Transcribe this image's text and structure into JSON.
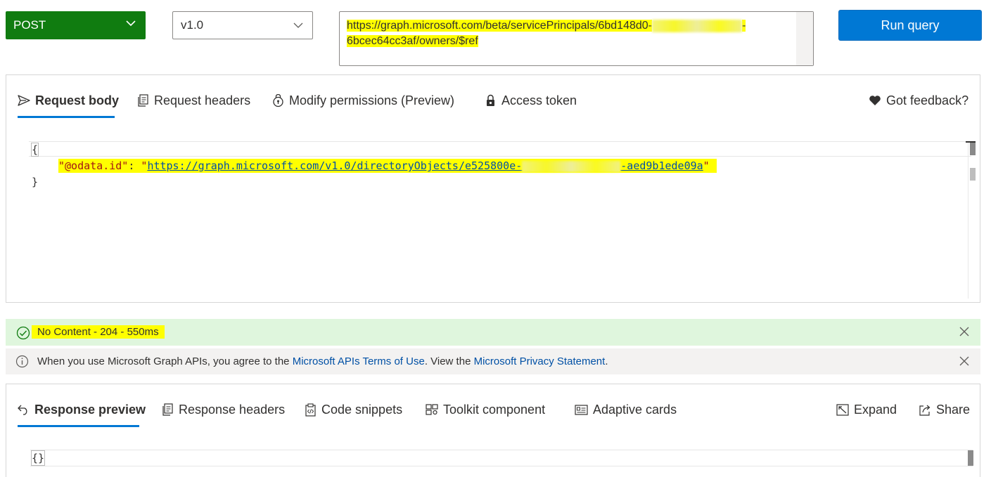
{
  "toolbar": {
    "method": "POST",
    "version": "v1.0",
    "url_line1_start": "https://graph.microsoft.com/beta/servicePrincipals/6bd148d0-",
    "url_line1_end": "-",
    "url_line2": "6bcec64cc3af/owners/$ref",
    "run_label": "Run query"
  },
  "request_tabs": [
    {
      "label": "Request body",
      "icon": "send-icon"
    },
    {
      "label": "Request headers",
      "icon": "headers-icon"
    },
    {
      "label": "Modify permissions (Preview)",
      "icon": "lock-key-icon"
    },
    {
      "label": "Access token",
      "icon": "shield-lock-icon"
    }
  ],
  "feedback_label": "Got feedback?",
  "request_body": {
    "open_brace": "{",
    "key": "\"@odata.id\"",
    "colon": ": ",
    "value_start": "https://graph.microsoft.com/v1.0/directoryObjects/e525800e-",
    "value_end": "-aed9b1ede09a",
    "close_brace": "}"
  },
  "status": {
    "text": "No Content - 204 - 550ms",
    "color": "#dff6dd"
  },
  "info": {
    "prefix": "When you use Microsoft Graph APIs, you agree to the ",
    "terms_link": "Microsoft APIs Terms of Use",
    "middle": ". View the ",
    "privacy_link": "Microsoft Privacy Statement",
    "suffix": "."
  },
  "response_tabs": [
    {
      "label": "Response preview",
      "icon": "undo-arrow-icon"
    },
    {
      "label": "Response headers",
      "icon": "headers-icon"
    },
    {
      "label": "Code snippets",
      "icon": "code-clipboard-icon"
    },
    {
      "label": "Toolkit component",
      "icon": "toolkit-icon"
    },
    {
      "label": "Adaptive cards",
      "icon": "card-icon"
    }
  ],
  "response_actions": {
    "expand_label": "Expand",
    "share_label": "Share"
  },
  "response_body": "{}",
  "colors": {
    "accent": "#0078d4",
    "method_bg": "#107c10",
    "highlight": "#ffff00"
  }
}
